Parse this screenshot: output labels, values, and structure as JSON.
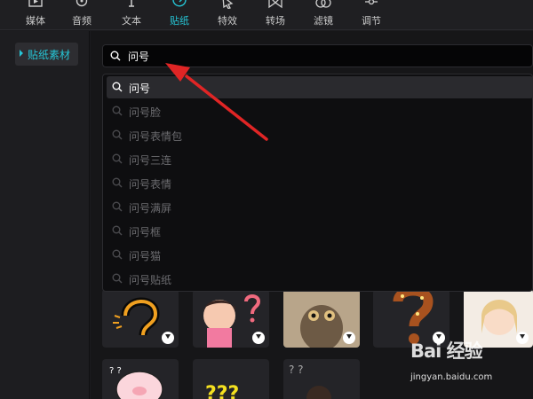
{
  "toolbar": {
    "tools": [
      {
        "label": "媒体",
        "icon": "media-icon"
      },
      {
        "label": "音频",
        "icon": "audio-icon"
      },
      {
        "label": "文本",
        "icon": "text-icon"
      },
      {
        "label": "贴纸",
        "icon": "sticker-icon",
        "active": true
      },
      {
        "label": "特效",
        "icon": "effects-icon"
      },
      {
        "label": "转场",
        "icon": "transition-icon"
      },
      {
        "label": "滤镜",
        "icon": "filter-icon"
      },
      {
        "label": "调节",
        "icon": "adjust-icon"
      }
    ],
    "active_color": "#26c6d6"
  },
  "sidebar": {
    "item_label": "贴纸素材"
  },
  "search": {
    "value": "问号"
  },
  "suggestions": [
    "问号",
    "问号脸",
    "问号表情包",
    "问号三连",
    "问号表情",
    "问号满屏",
    "问号框",
    "问号猫",
    "问号贴纸"
  ],
  "watermark": {
    "logo": "Bai 经验",
    "url": "jingyan.baidu.com"
  }
}
